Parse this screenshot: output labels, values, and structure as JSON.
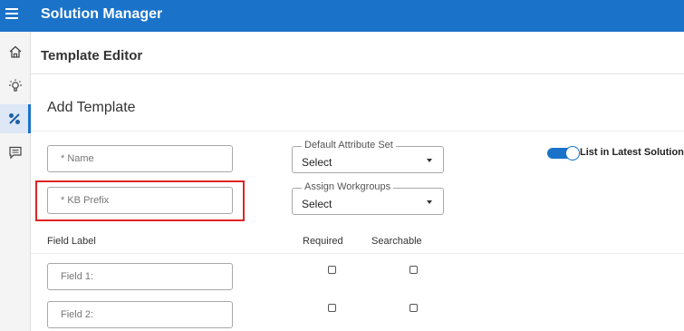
{
  "app": {
    "title": "Solution Manager"
  },
  "sidebar": {
    "items": [
      {
        "icon": "home-icon"
      },
      {
        "icon": "lightbulb-icon"
      },
      {
        "icon": "tools-icon",
        "active": true
      },
      {
        "icon": "comment-icon"
      }
    ]
  },
  "page": {
    "title": "Template Editor"
  },
  "form": {
    "section_title": "Add Template",
    "name_placeholder": "* Name",
    "kb_prefix_placeholder": "* KB Prefix",
    "default_attribute_set": {
      "legend": "Default Attribute Set",
      "value": "Select"
    },
    "assign_workgroups": {
      "legend": "Assign Workgroups",
      "value": "Select"
    },
    "list_in_latest": {
      "label": "List in Latest Solutions",
      "on": true
    }
  },
  "fields": {
    "headers": {
      "label": "Field Label",
      "required": "Required",
      "searchable": "Searchable"
    },
    "rows": [
      {
        "placeholder": "Field 1:",
        "required": false,
        "searchable": false
      },
      {
        "placeholder": "Field 2:",
        "required": false,
        "searchable": false
      }
    ]
  },
  "colors": {
    "accent": "#1a73c9",
    "highlight": "#e02424"
  }
}
